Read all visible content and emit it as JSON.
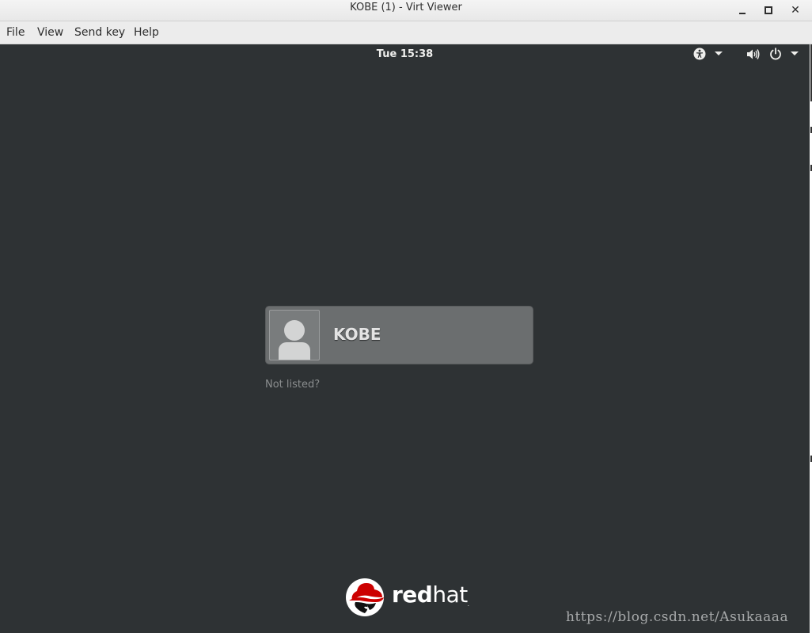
{
  "window": {
    "title": "KOBE (1) - Virt Viewer"
  },
  "menubar": {
    "file": "File",
    "view": "View",
    "send_key": "Send key",
    "help": "Help"
  },
  "topbar": {
    "clock": "Tue 15:38",
    "icons": [
      "accessibility-icon",
      "chevron-down-icon",
      "volume-icon",
      "power-icon",
      "chevron-down-icon"
    ]
  },
  "login": {
    "users": [
      {
        "name": "KOBE"
      }
    ],
    "not_listed": "Not listed?"
  },
  "logo": {
    "red": "red",
    "hat": "hat",
    "tm": "."
  },
  "watermark": "https://blog.csdn.net/Asukaaaa",
  "colors": {
    "display_bg": "#2e3234",
    "user_entry_bg": "#6b6e6f",
    "redhat_red": "#cc0000"
  }
}
